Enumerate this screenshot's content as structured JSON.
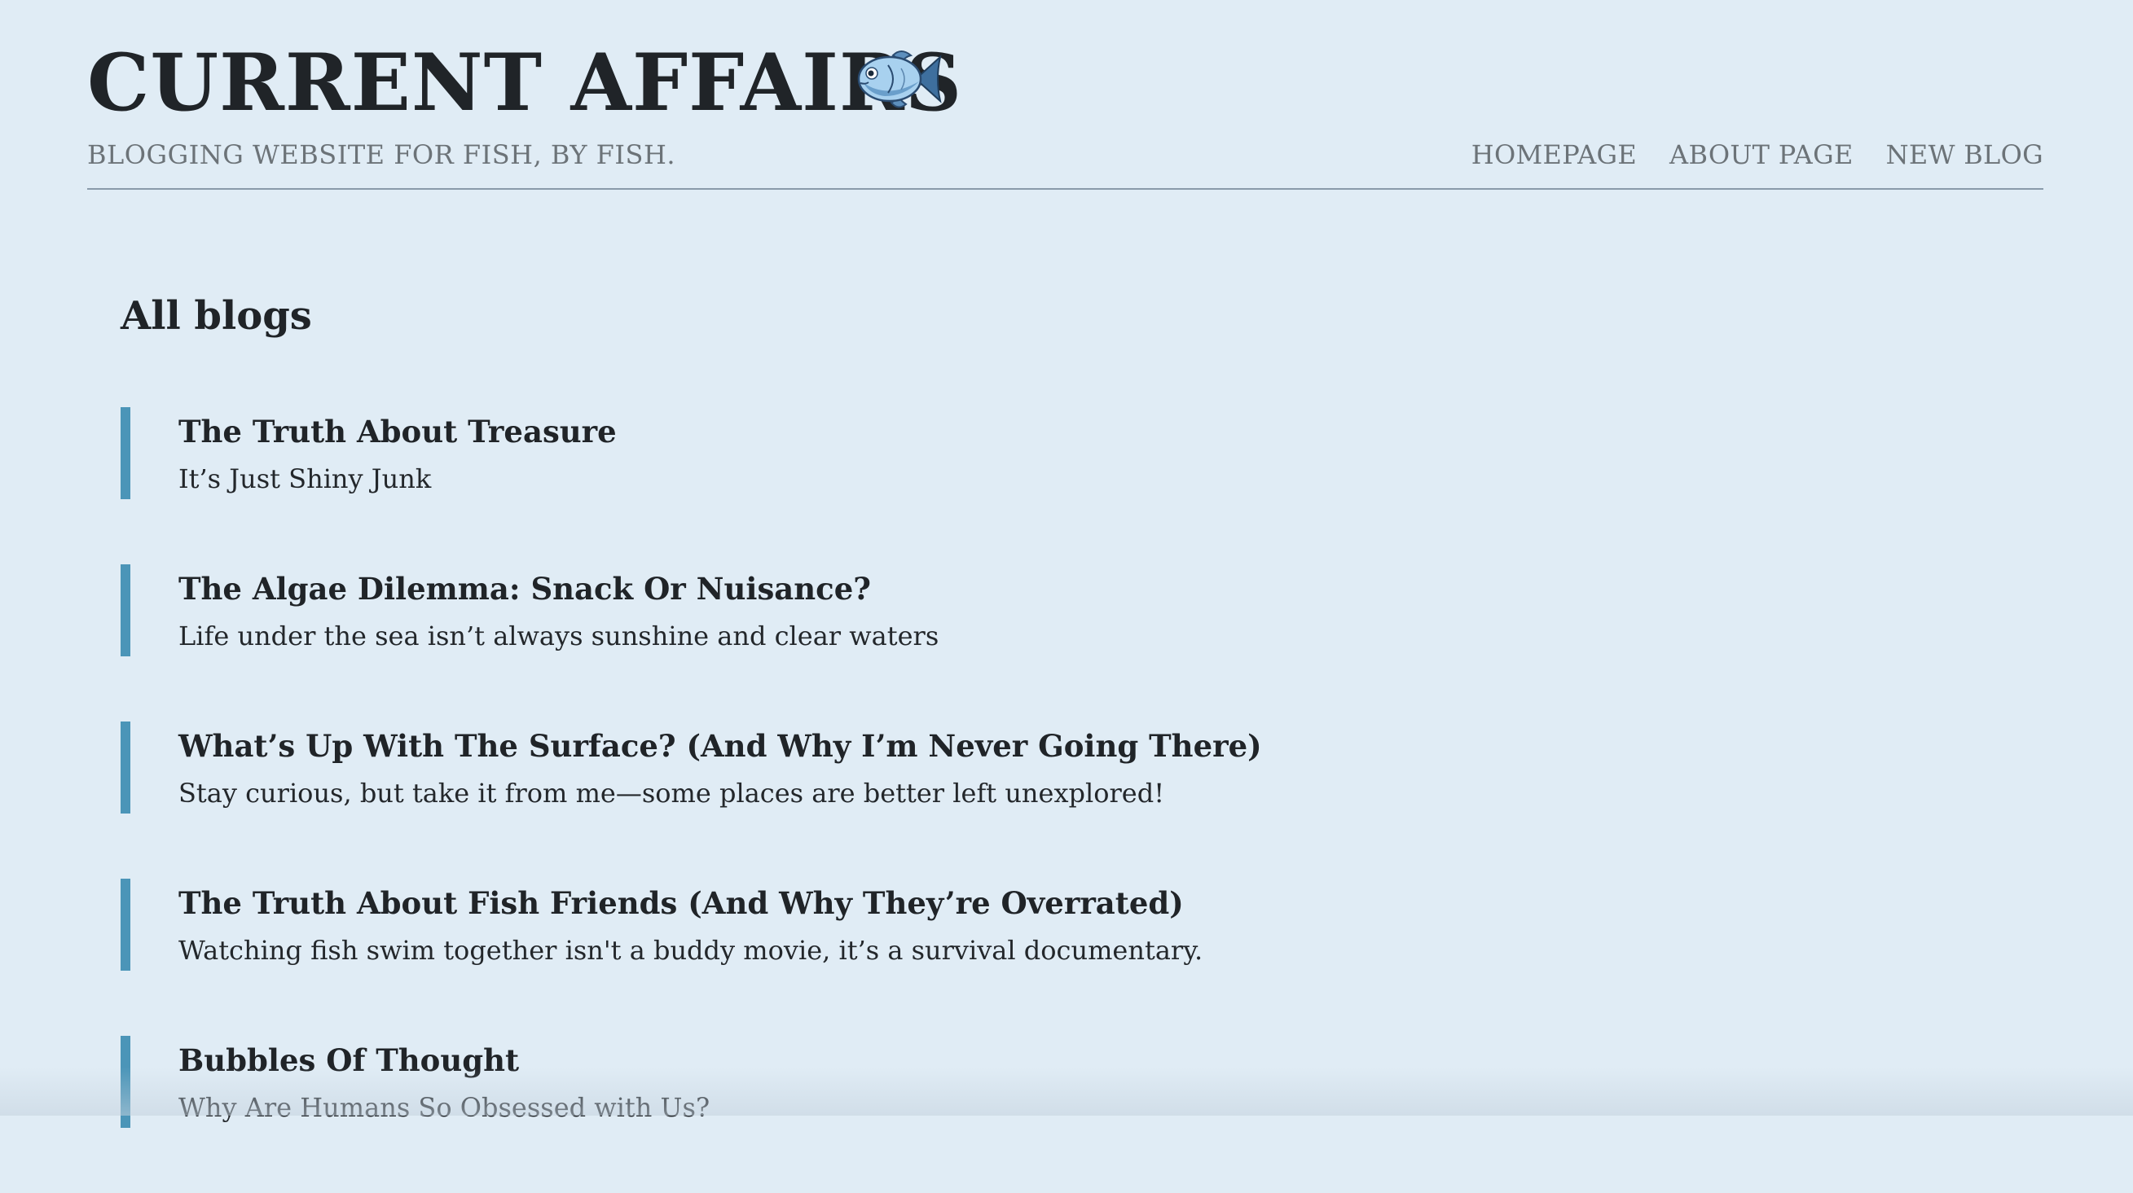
{
  "header": {
    "title": "CURRENT AFFAIRS",
    "title_icon": "fish-icon",
    "tagline": "BLOGGING WEBSITE FOR FISH, BY FISH."
  },
  "nav": {
    "items": [
      {
        "label": "HOMEPAGE"
      },
      {
        "label": "ABOUT PAGE"
      },
      {
        "label": "NEW BLOG"
      }
    ]
  },
  "main": {
    "heading": "All blogs",
    "blogs": [
      {
        "title": "The Truth About Treasure",
        "subtitle": "It’s Just Shiny Junk"
      },
      {
        "title": "The Algae Dilemma: Snack Or Nuisance?",
        "subtitle": "Life under the sea isn’t always sunshine and clear waters"
      },
      {
        "title": "What’s Up With The Surface? (And Why I’m Never Going There)",
        "subtitle": "Stay curious, but take it from me—some places are better left unexplored!"
      },
      {
        "title": "The Truth About Fish Friends (And Why They’re Overrated)",
        "subtitle": "Watching fish swim together isn't a buddy movie, it’s a survival documentary."
      },
      {
        "title": "Bubbles Of Thought",
        "subtitle": "Why Are Humans So Obsessed with Us?"
      }
    ]
  },
  "colors": {
    "background": "#e0ecf5",
    "accent_bar": "#4b95b8",
    "muted_text": "#6c7378",
    "heading_text": "#202428"
  }
}
